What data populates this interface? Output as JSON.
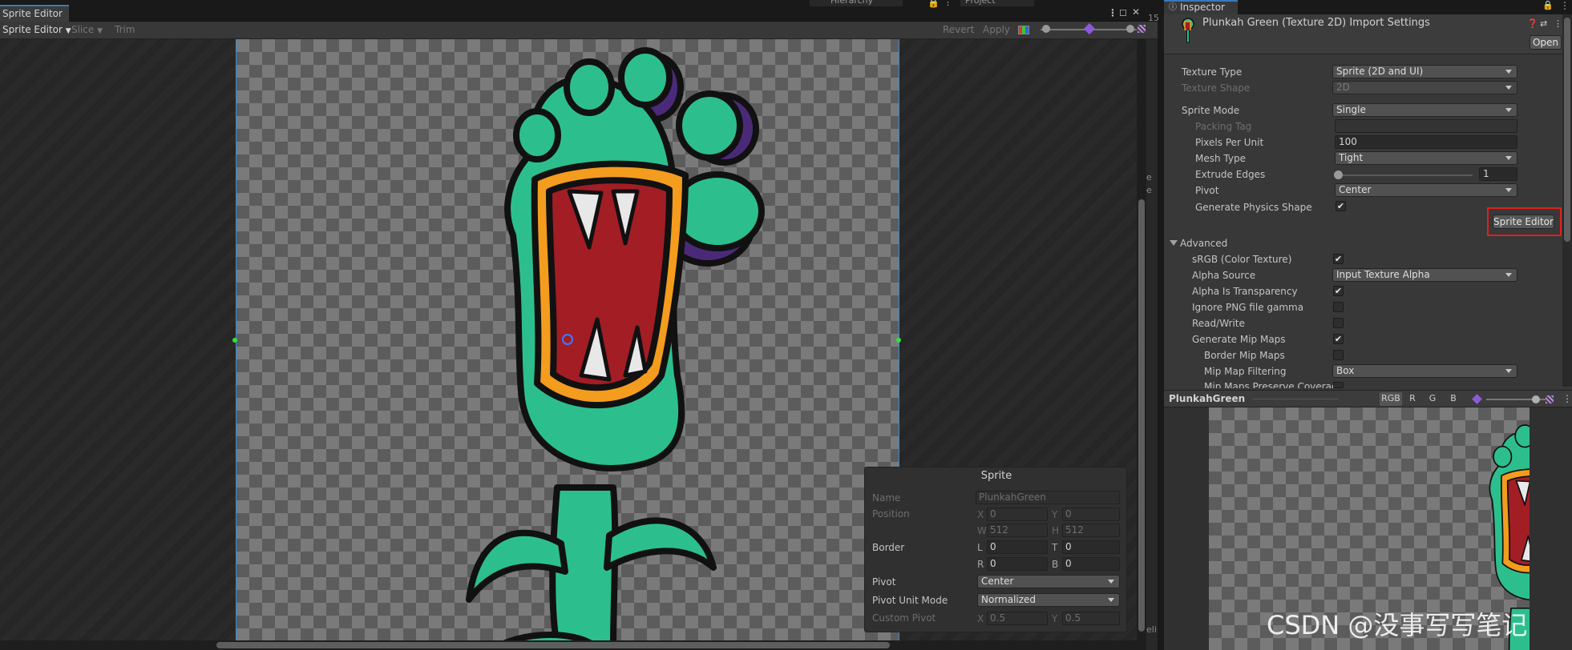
{
  "sprite_editor": {
    "tab": "Sprite Editor",
    "hierarchy_tab": "Hierarchy",
    "project_tab": "Project",
    "toolbar": {
      "mode": "Sprite Editor",
      "slice": "Slice",
      "trim": "Trim",
      "revert": "Revert",
      "apply": "Apply"
    }
  },
  "sprite_panel": {
    "title": "Sprite",
    "name_label": "Name",
    "name_value": "PlunkahGreen",
    "position_label": "Position",
    "pos_x": "0",
    "pos_y": "0",
    "pos_w": "512",
    "pos_h": "512",
    "border_label": "Border",
    "border_l": "0",
    "border_t": "0",
    "border_r": "0",
    "border_b": "0",
    "pivot_label": "Pivot",
    "pivot_value": "Center",
    "pivot_unit_label": "Pivot Unit Mode",
    "pivot_unit_value": "Normalized",
    "custom_pivot_label": "Custom Pivot",
    "custom_x": "0.5",
    "custom_y": "0.5",
    "axes": {
      "x": "X",
      "y": "Y",
      "w": "W",
      "h": "H",
      "l": "L",
      "t": "T",
      "r": "R",
      "b": "B"
    }
  },
  "edge_peeks": {
    "top": "15",
    "mid": "e\ne",
    "bottom": "eli"
  },
  "inspector": {
    "tab": "Inspector",
    "title": "Plunkah Green (Texture 2D) Import Settings",
    "open_label": "Open",
    "rows": {
      "texture_type": {
        "label": "Texture Type",
        "value": "Sprite (2D and UI)"
      },
      "texture_shape": {
        "label": "Texture Shape",
        "value": "2D"
      },
      "sprite_mode": {
        "label": "Sprite Mode",
        "value": "Single"
      },
      "packing_tag": {
        "label": "Packing Tag",
        "value": ""
      },
      "pixels_per_unit": {
        "label": "Pixels Per Unit",
        "value": "100"
      },
      "mesh_type": {
        "label": "Mesh Type",
        "value": "Tight"
      },
      "extrude_edges": {
        "label": "Extrude Edges",
        "value": "1"
      },
      "pivot": {
        "label": "Pivot",
        "value": "Center"
      },
      "generate_physics_shape": {
        "label": "Generate Physics Shape",
        "checked": true
      },
      "advanced": {
        "label": "Advanced"
      },
      "srgb": {
        "label": "sRGB (Color Texture)",
        "checked": true
      },
      "alpha_source": {
        "label": "Alpha Source",
        "value": "Input Texture Alpha"
      },
      "alpha_is_transparency": {
        "label": "Alpha Is Transparency",
        "checked": true
      },
      "ignore_png_gamma": {
        "label": "Ignore PNG file gamma",
        "checked": false
      },
      "read_write": {
        "label": "Read/Write",
        "checked": false
      },
      "generate_mip_maps": {
        "label": "Generate Mip Maps",
        "checked": true
      },
      "border_mip_maps": {
        "label": "Border Mip Maps",
        "checked": false
      },
      "mip_map_filtering": {
        "label": "Mip Map Filtering",
        "value": "Box"
      },
      "mip_maps_preserve_coverage": {
        "label": "Mip Maps Preserve Coverag",
        "checked": false
      }
    },
    "sprite_editor_button": "Sprite Editor",
    "check_mark": "✔",
    "preview": {
      "name": "PlunkahGreen",
      "channels": [
        "RGB",
        "R",
        "G",
        "B"
      ]
    }
  },
  "extrude_edges_fraction": 0.0,
  "watermark": "CSDN @没事写写笔记",
  "colors": {
    "highlight": "#e02020",
    "accent_blue": "#3a79bb",
    "sprite_green": "#2cbf8d"
  }
}
